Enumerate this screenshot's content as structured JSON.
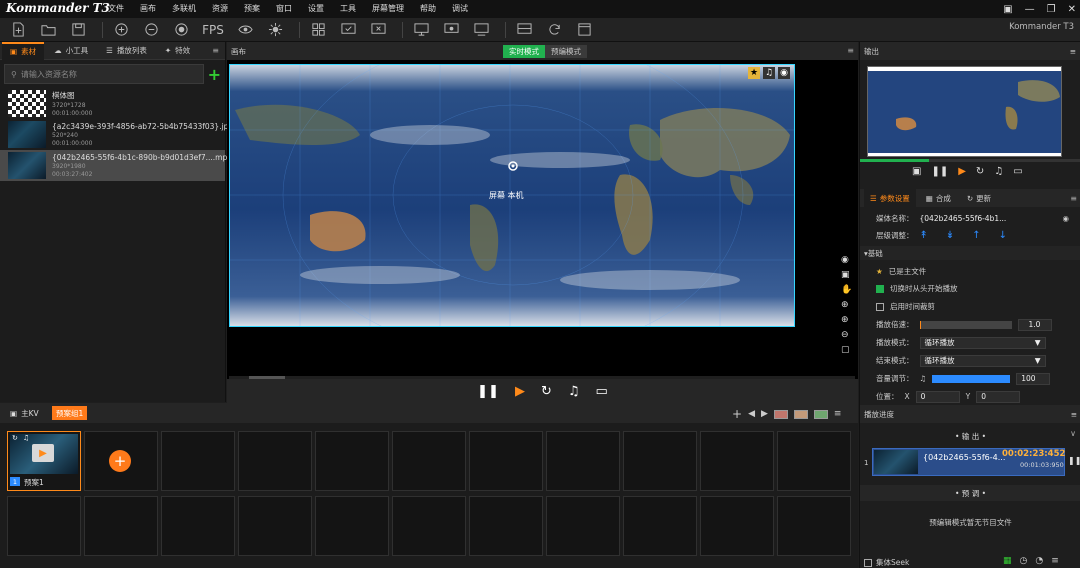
{
  "app": {
    "logo": "Kommander T3",
    "name": "Kommander T3",
    "menu": [
      "文件",
      "画布",
      "多联机",
      "资源",
      "预案",
      "窗口",
      "设置",
      "工具",
      "屏幕管理",
      "帮助",
      "调试"
    ]
  },
  "toolbar": {
    "fps_label": "FPS"
  },
  "left": {
    "tabs": [
      "素材",
      "小工具",
      "播放列表",
      "特效"
    ],
    "search_placeholder": "请输入资源名称",
    "resources": [
      {
        "name": "棋体图",
        "size": "3720*1728",
        "duration": "00:01:00:000"
      },
      {
        "name": "{a2c3439e-393f-4856-ab72-5b4b75433f03}.jpg",
        "size": "520*240",
        "duration": "00:01:00:000"
      },
      {
        "name": "{042b2465-55f6-4b1c-890b-b9d01d3ef7....mp4",
        "size": "3920*1980",
        "duration": "00:03:27:402"
      }
    ]
  },
  "canvas": {
    "title": "画布",
    "mode_live": "实时模式",
    "mode_edit": "预编模式",
    "screen_label": "屏幕 本机"
  },
  "output": {
    "title": "输出",
    "progress": 0.31
  },
  "params": {
    "tabs": [
      "参数设置",
      "合成",
      "更新"
    ],
    "media_name_label": "媒体名称：",
    "media_name_value": "{042b2465-55f6-4b1...",
    "layer_label": "层级调整：",
    "section_basic": "▾基础",
    "is_main_file": "已是主文件",
    "restart_on_switch": "切换时从头开始播放",
    "enable_time_crop": "启用时间裁剪",
    "speed_label": "播放倍速：",
    "speed_value": "1.0",
    "speed_fill": 0.02,
    "play_mode_label": "播放模式：",
    "play_mode_value": "循环播放",
    "end_mode_label": "结束模式：",
    "end_mode_value": "循环播放",
    "volume_label": "音量调节：",
    "volume_value": "100",
    "volume_fill": 1.0,
    "position_label": "位置：",
    "pos_x_label": "X",
    "pos_x_value": "0",
    "pos_y_label": "Y",
    "pos_y_value": "0"
  },
  "playlist": {
    "title": "播放进度",
    "output_group": "• 输 出 •",
    "item_index": "1",
    "item_name": "{042b2465-55f6-4...",
    "item_time": "00:02:23:452",
    "item_duration": "00:01:03:950",
    "preview_group": "• 预 调 •",
    "preview_empty": "预编辑模式暂无节目文件",
    "seek_label": "集体Seek"
  },
  "scenes": {
    "kv_label": "主KV",
    "group_label": "预案组1",
    "first_scene_num": "1",
    "first_scene_name": "预案1"
  }
}
